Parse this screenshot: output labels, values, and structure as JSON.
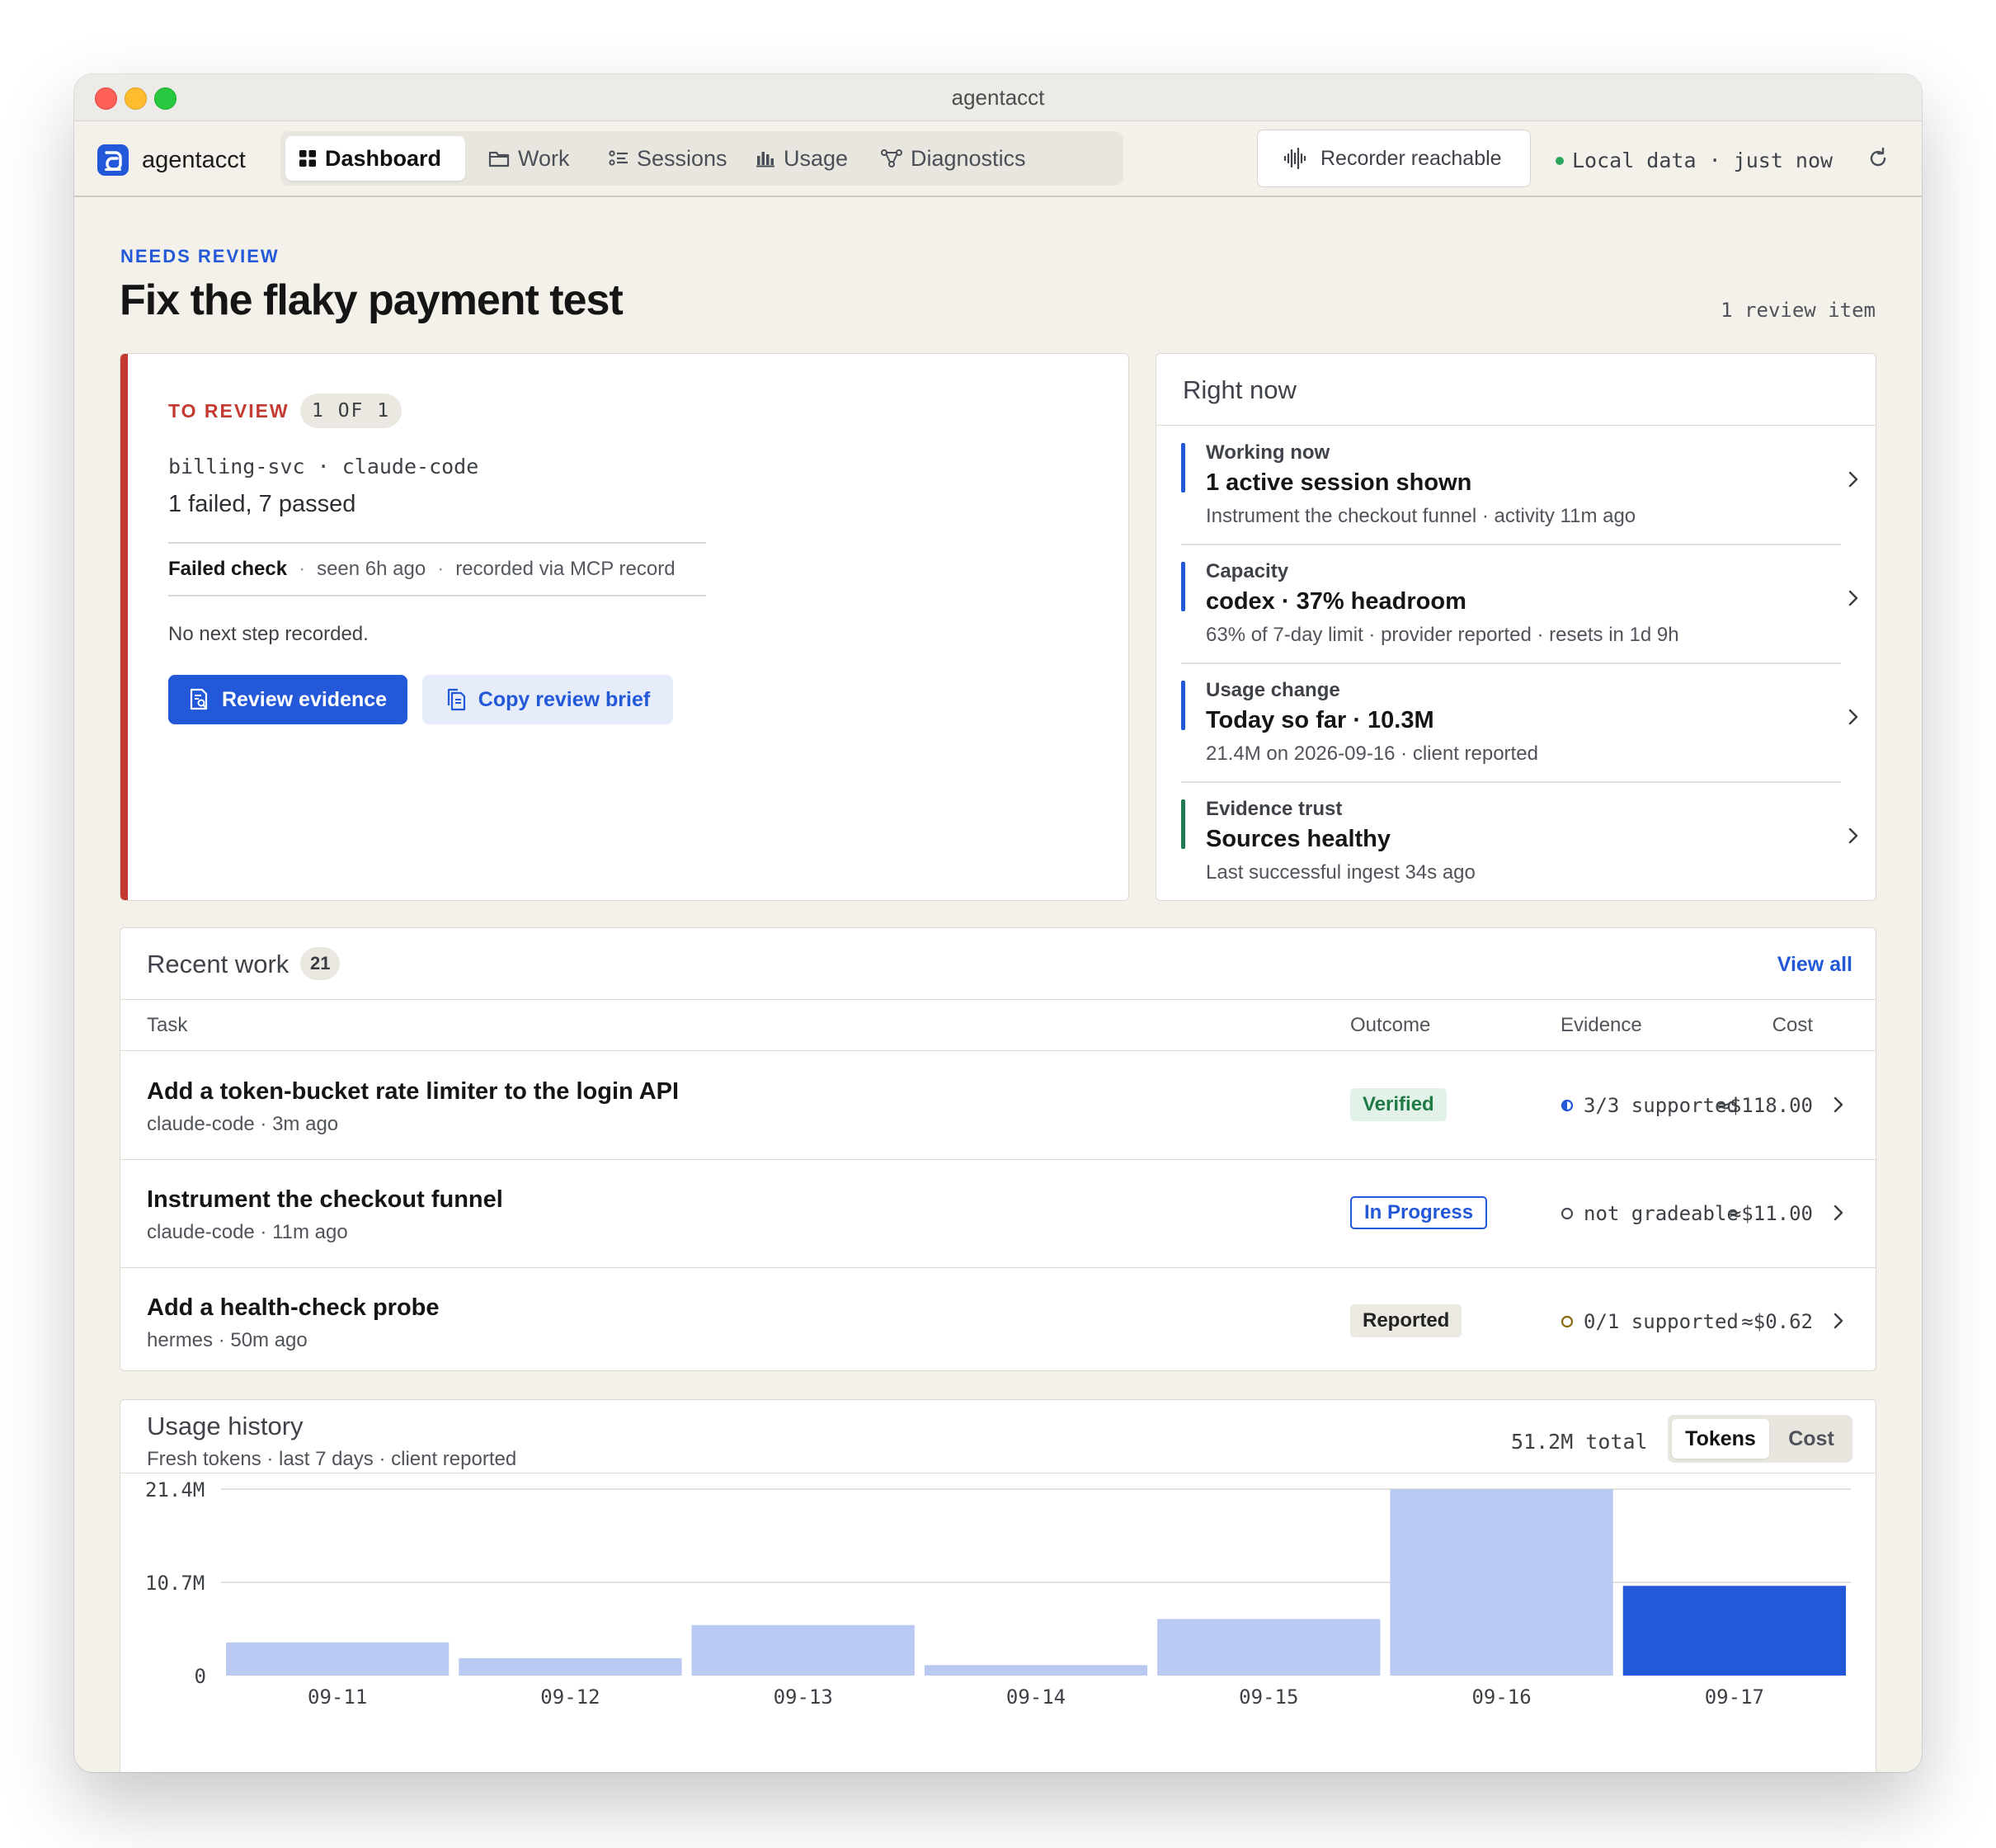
{
  "window": {
    "title": "agentacct"
  },
  "app": {
    "brand": "agentacct"
  },
  "nav": {
    "items": [
      {
        "label": "Dashboard",
        "icon": "grid-icon",
        "active": true
      },
      {
        "label": "Work",
        "icon": "folder-icon",
        "active": false
      },
      {
        "label": "Sessions",
        "icon": "list-icon",
        "active": false
      },
      {
        "label": "Usage",
        "icon": "bar-chart-icon",
        "active": false
      },
      {
        "label": "Diagnostics",
        "icon": "network-icon",
        "active": false
      }
    ]
  },
  "status": {
    "recorder": "Recorder reachable",
    "local_data": "Local data · just now"
  },
  "header": {
    "eyebrow": "NEEDS REVIEW",
    "title": "Fix the flaky payment test",
    "review_count": "1 review item"
  },
  "review": {
    "label": "TO REVIEW",
    "position": "1 OF 1",
    "repo": "billing-svc · claude-code",
    "result": "1 failed, 7 passed",
    "check": {
      "name": "Failed check",
      "seen": "seen 6h ago",
      "source": "recorded via MCP record"
    },
    "next_step": "No next step recorded.",
    "primary_button": "Review evidence",
    "secondary_button": "Copy review brief"
  },
  "right_now": {
    "title": "Right now",
    "items": [
      {
        "label": "Working now",
        "headline": "1 active session shown",
        "detail": "Instrument the checkout funnel · activity 11m ago"
      },
      {
        "label": "Capacity",
        "headline": "codex · 37% headroom",
        "detail": "63% of 7-day limit · provider reported · resets in 1d 9h"
      },
      {
        "label": "Usage change",
        "headline": "Today so far · 10.3M",
        "detail": "21.4M on 2026-09-16 · client reported"
      },
      {
        "label": "Evidence trust",
        "headline": "Sources healthy",
        "detail": "Last successful ingest 34s ago"
      }
    ]
  },
  "recent_work": {
    "title": "Recent work",
    "count": "21",
    "view_all": "View all",
    "columns": {
      "task": "Task",
      "outcome": "Outcome",
      "evidence": "Evidence",
      "cost": "Cost"
    },
    "rows": [
      {
        "task": "Add a token-bucket rate limiter to the login API",
        "meta": "claude-code · 3m ago",
        "outcome": "Verified",
        "evidence": "3/3 supported",
        "cost": "≈$118.00"
      },
      {
        "task": "Instrument the checkout funnel",
        "meta": "claude-code · 11m ago",
        "outcome": "In Progress",
        "evidence": "not gradeable",
        "cost": "≈$11.00"
      },
      {
        "task": "Add a health-check probe",
        "meta": "hermes · 50m ago",
        "outcome": "Reported",
        "evidence": "0/1 supported",
        "cost": "≈$0.62"
      }
    ]
  },
  "usage_history": {
    "title": "Usage history",
    "subtitle": "Fresh tokens · last 7 days · client reported",
    "total": "51.2M total",
    "toggle": {
      "tokens": "Tokens",
      "cost": "Cost"
    }
  },
  "colors": {
    "accent": "#2358d9",
    "bar_light": "#b9c9f2",
    "alert": "#c43a31",
    "success": "#1f7a46"
  },
  "chart_data": {
    "type": "bar",
    "categories": [
      "09-11",
      "09-12",
      "09-13",
      "09-14",
      "09-15",
      "09-16",
      "09-17"
    ],
    "values": [
      3.8,
      2.0,
      5.8,
      1.2,
      6.5,
      21.4,
      10.3
    ],
    "unit": "M",
    "ylim": [
      0,
      21.4
    ],
    "ytick_labels": [
      "0",
      "10.7M",
      "21.4M"
    ],
    "ytick_values": [
      0,
      10.7,
      21.4
    ],
    "highlight_index": 6,
    "grid": true
  }
}
